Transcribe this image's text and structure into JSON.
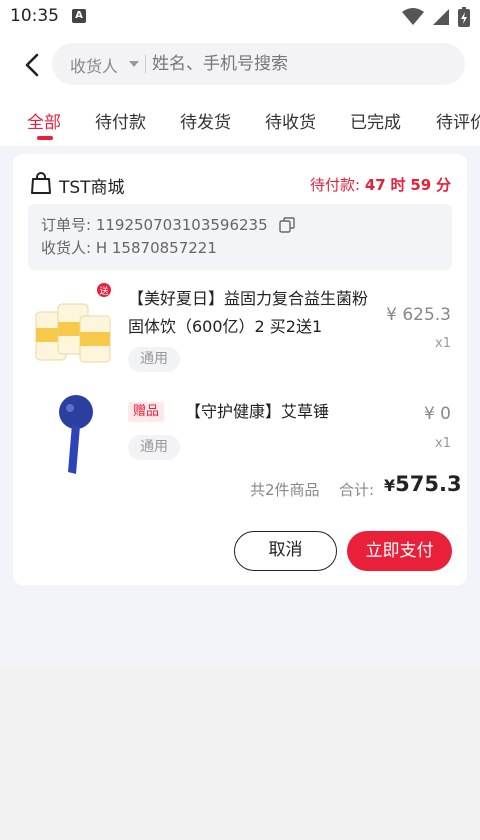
{
  "status_bar": {
    "time": "10:35",
    "notif_icon": "a-icon"
  },
  "search": {
    "scope": "收货人",
    "placeholder": "姓名、手机号搜索"
  },
  "tabs": [
    {
      "label": "全部"
    },
    {
      "label": "待付款"
    },
    {
      "label": "待发货"
    },
    {
      "label": "待收货"
    },
    {
      "label": "已完成"
    },
    {
      "label": "待评价"
    }
  ],
  "order": {
    "shop_name": "TST商城",
    "status_label": "待付款:",
    "countdown_min": "47",
    "countdown_min_unit": "时",
    "countdown_sec": "59",
    "countdown_sec_unit": "分",
    "order_no_label": "订单号:",
    "order_no": "119250703103596235",
    "recipient_label": "收货人:",
    "recipient": "H 15870857221",
    "items": [
      {
        "title_line1": "【美好夏日】益固力复合益生菌粉",
        "title_line2": "固体饮（600亿）2 买2送1",
        "tag": "通用",
        "price": "¥ 625.3",
        "qty": "x1",
        "img_badge": "送"
      },
      {
        "gift_badge": "赠品",
        "title_line1": "【守护健康】艾草锤",
        "tag": "通用",
        "price": "¥ 0",
        "qty": "x1"
      }
    ],
    "summary_count": "共2件商品",
    "summary_label": "合计:",
    "currency": "¥",
    "total": "575.3",
    "cancel_label": "取消",
    "pay_label": "立即支付"
  },
  "colors": {
    "accent": "#e8203a"
  }
}
